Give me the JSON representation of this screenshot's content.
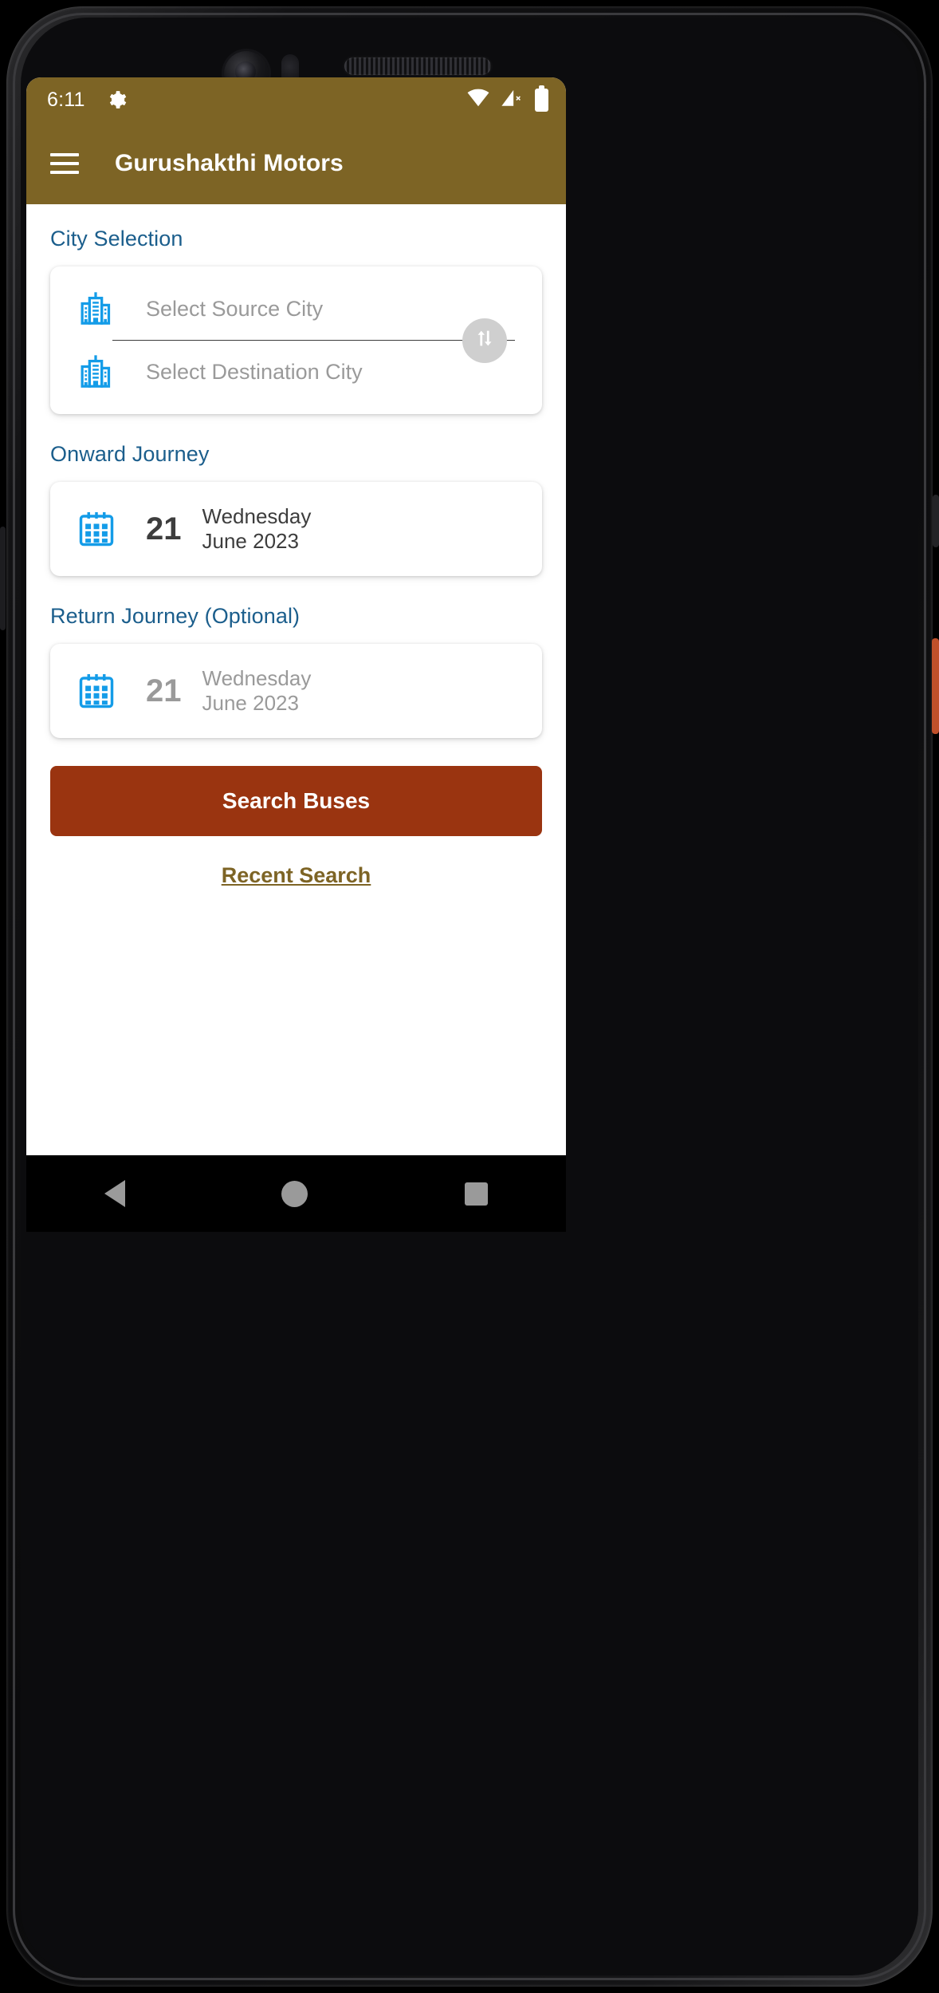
{
  "status_bar": {
    "clock": "6:11",
    "gear_icon": "gear-icon",
    "wifi_icon": "wifi-icon",
    "signal_icon": "signal-no-service-icon",
    "battery_icon": "battery-icon"
  },
  "app_bar": {
    "menu_icon": "hamburger-menu-icon",
    "title": "Gurushakthi Motors"
  },
  "city_section": {
    "label": "City Selection",
    "source_icon": "buildings-icon",
    "source_placeholder": "Select Source City",
    "destination_icon": "buildings-icon",
    "destination_placeholder": "Select Destination City",
    "swap_icon": "swap-vertical-icon"
  },
  "onward_journey": {
    "label": "Onward Journey",
    "calendar_icon": "calendar-icon",
    "day": "21",
    "weekday": "Wednesday",
    "month_year": "June 2023"
  },
  "return_journey": {
    "label": "Return Journey (Optional)",
    "calendar_icon": "calendar-icon",
    "day": "21",
    "weekday": "Wednesday",
    "month_year": "June 2023"
  },
  "actions": {
    "search_label": "Search Buses",
    "recent_label": "Recent Search"
  },
  "nav_bar": {
    "back_icon": "back-triangle-icon",
    "home_icon": "home-circle-icon",
    "recents_icon": "recents-square-icon"
  },
  "colors": {
    "brand_olive": "#7d6425",
    "accent_blue": "#1b5e8c",
    "icon_blue": "#149ce8",
    "action_red": "#9a3410",
    "muted_gray": "#9a9a9a"
  }
}
